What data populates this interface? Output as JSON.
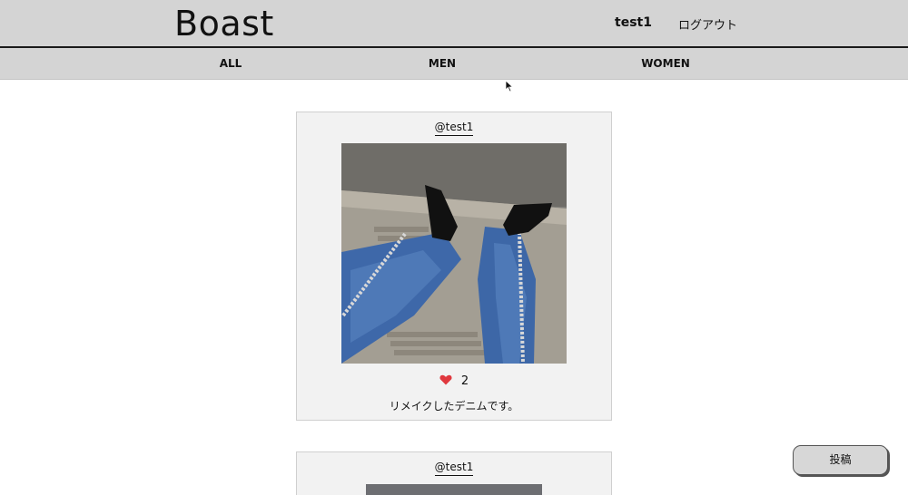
{
  "header": {
    "logo": "Boast",
    "username": "test1",
    "logout_label": "ログアウト"
  },
  "nav": {
    "items": [
      {
        "label": "ALL"
      },
      {
        "label": "MEN"
      },
      {
        "label": "WOMEN"
      }
    ]
  },
  "posts": [
    {
      "user": "@test1",
      "like_count": "2",
      "caption": "リメイクしたデニムです。"
    },
    {
      "user": "@test1"
    }
  ],
  "actions": {
    "post_button_label": "投稿"
  },
  "colors": {
    "header_bg": "#d4d4d4",
    "card_bg": "#f2f2f2",
    "heart": "#e0383e"
  }
}
